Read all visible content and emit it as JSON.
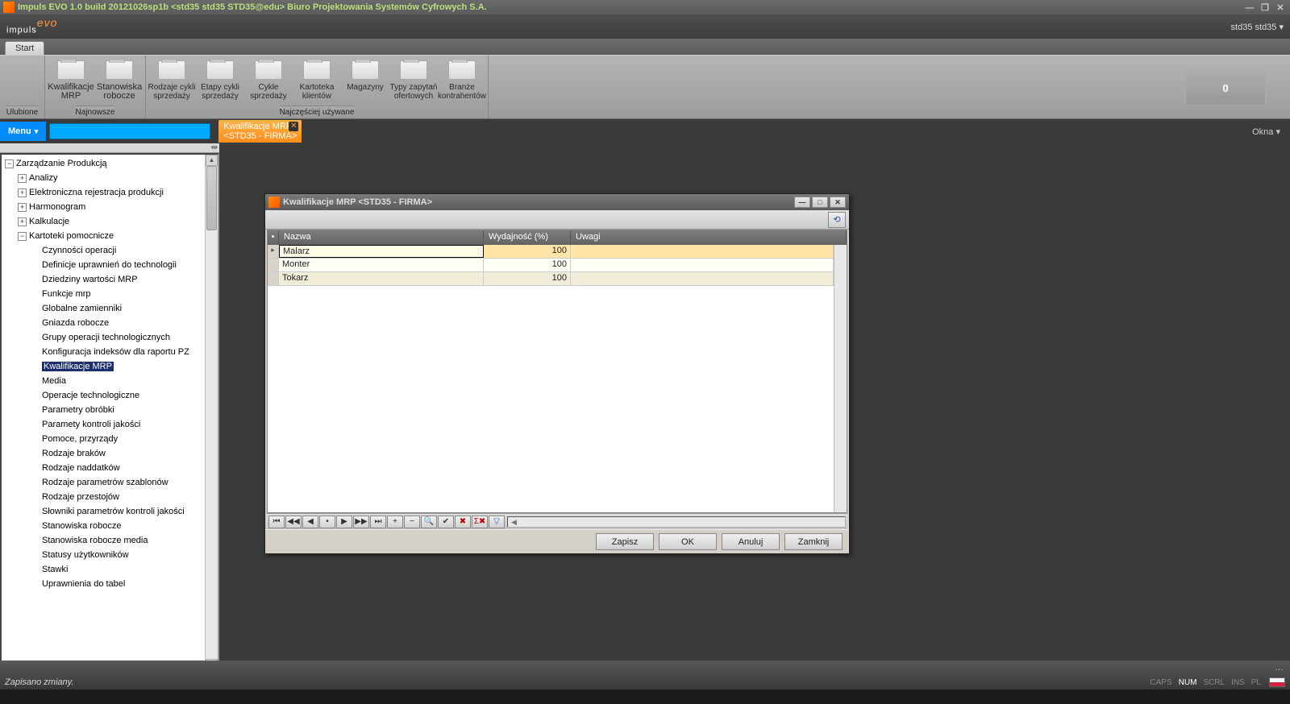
{
  "titlebar": {
    "text": "Impuls EVO 1.0 build 20121026sp1b <std35 std35 STD35@edu> Biuro Projektowania Systemów Cyfrowych S.A."
  },
  "banner": {
    "logo_main": "impuls",
    "logo_sub": "evo",
    "user": "std35 std35 ▾"
  },
  "tabrow": {
    "start": "Start"
  },
  "ribbon": {
    "groups": [
      {
        "label": "Ulubione",
        "items": []
      },
      {
        "label": "Najnowsze",
        "items": [
          {
            "l1": "Kwalifikacje",
            "l2": "MRP"
          },
          {
            "l1": "Stanowiska",
            "l2": "robocze"
          }
        ]
      },
      {
        "label": "Najczęściej używane",
        "items": [
          {
            "l1": "Rodzaje cykli",
            "l2": "sprzedaży"
          },
          {
            "l1": "Etapy cykli",
            "l2": "sprzedaży"
          },
          {
            "l1": "Cykle",
            "l2": "sprzedaży"
          },
          {
            "l1": "Kartoteka",
            "l2": "klientów"
          },
          {
            "l1": "Magazyny",
            "l2": ""
          },
          {
            "l1": "Typy zapytań",
            "l2": "ofertowych"
          },
          {
            "l1": "Branże",
            "l2": "kontrahentów"
          }
        ]
      }
    ],
    "rightbox": "0"
  },
  "docstrip": {
    "menu": "Menu",
    "tab_line1": "Kwalifikacje MRP",
    "tab_line2": "<STD35 - FIRMA>",
    "okna": "Okna ▾"
  },
  "tree": {
    "root": "Zarządzanie Produkcją",
    "l1": [
      {
        "exp": "+",
        "label": "Analizy"
      },
      {
        "exp": "+",
        "label": "Elektroniczna rejestracja produkcji"
      },
      {
        "exp": "+",
        "label": "Harmonogram"
      },
      {
        "exp": "+",
        "label": "Kalkulacje"
      },
      {
        "exp": "−",
        "label": "Kartoteki pomocnicze"
      }
    ],
    "leaves": [
      "Czynności operacji",
      "Definicje uprawnień do technologii",
      "Dziedziny wartości MRP",
      "Funkcje mrp",
      "Globalne zamienniki",
      "Gniazda robocze",
      "Grupy operacji technologicznych",
      "Konfiguracja indeksów dla raportu PZ",
      "Kwalifikacje MRP",
      "Media",
      "Operacje technologiczne",
      "Parametry obróbki",
      "Paramety kontroli jakości",
      "Pomoce, przyrządy",
      "Rodzaje braków",
      "Rodzaje naddatków",
      "Rodzaje parametrów szablonów",
      "Rodzaje przestojów",
      "Słowniki parametrów kontroli jakości",
      "Stanowiska robocze",
      "Stanowiska robocze media",
      "Statusy użytkowników",
      "Stawki",
      "Uprawnienia do tabel"
    ],
    "selected_index": 8
  },
  "inwin": {
    "title": "Kwalifikacje MRP <STD35 - FIRMA>",
    "columns": {
      "sel": "•",
      "nazwa": "Nazwa",
      "wyd": "Wydajność (%)",
      "uwagi": "Uwagi"
    },
    "rows": [
      {
        "nazwa": "Malarz",
        "wyd": "100",
        "uwagi": ""
      },
      {
        "nazwa": "Monter",
        "wyd": "100",
        "uwagi": ""
      },
      {
        "nazwa": "Tokarz",
        "wyd": "100",
        "uwagi": ""
      }
    ],
    "nav": {
      "first": "⏮",
      "prevpg": "◀◀",
      "prev": "◀",
      "marker": "•",
      "next": "▶",
      "nextpg": "▶▶",
      "last": "⏭",
      "add": "+",
      "del": "−",
      "zoom": "🔍",
      "ok": "✔",
      "cancel": "✖",
      "sum": "Σ✖",
      "filter": "▽"
    },
    "buttons": {
      "zapisz": "Zapisz",
      "ok": "OK",
      "anuluj": "Anuluj",
      "zamknij": "Zamknij"
    }
  },
  "footer": {
    "status": "Zapisano zmiany.",
    "caps": "CAPS",
    "num": "NUM",
    "scrl": "SCRL",
    "ins": "INS",
    "lang": "PL"
  }
}
